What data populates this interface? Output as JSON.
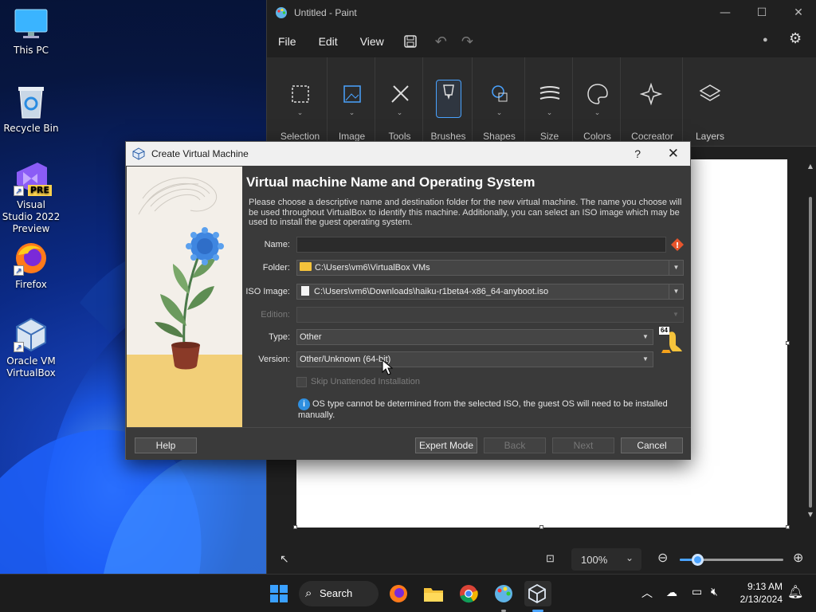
{
  "desktop": {
    "icons": [
      {
        "label": "This PC"
      },
      {
        "label": "Recycle Bin"
      },
      {
        "label": "Visual Studio 2022 Preview",
        "badge": "PRE"
      },
      {
        "label": "Firefox"
      },
      {
        "label": "Oracle VM VirtualBox"
      }
    ]
  },
  "paint": {
    "title": "Untitled - Paint",
    "menu": [
      "File",
      "Edit",
      "View"
    ],
    "ribbon_groups": [
      "Selection",
      "Image",
      "Tools",
      "Brushes",
      "Shapes",
      "Size",
      "Colors",
      "Cocreator",
      "Layers"
    ],
    "zoom": "100%",
    "zoom_slider_fraction": 0.17
  },
  "dialog": {
    "title": "Create Virtual Machine",
    "help_glyph": "?",
    "heading": "Virtual machine Name and Operating System",
    "description": "Please choose a descriptive name and destination folder for the new virtual machine. The name you choose will be used throughout VirtualBox to identify this machine. Additionally, you can select an ISO image which may be used to install the guest operating system.",
    "fields": {
      "name_label": "Name:",
      "name_value": "",
      "folder_label": "Folder:",
      "folder_value": "C:\\Users\\vm6\\VirtualBox VMs",
      "iso_label": "ISO Image:",
      "iso_value": "C:\\Users\\vm6\\Downloads\\haiku-r1beta4-x86_64-anyboot.iso",
      "edition_label": "Edition:",
      "edition_value": "",
      "type_label": "Type:",
      "type_value": "Other",
      "version_label": "Version:",
      "version_value": "Other/Unknown (64-bit)",
      "os_badge": "64"
    },
    "skip_unattended": "Skip Unattended Installation",
    "info_text": "OS type cannot be determined from the selected ISO, the guest OS will need to be installed manually.",
    "buttons": {
      "help": "Help",
      "expert": "Expert Mode",
      "back": "Back",
      "next": "Next",
      "cancel": "Cancel"
    }
  },
  "taskbar": {
    "search": "Search",
    "time": "9:13 AM",
    "date": "2/13/2024"
  },
  "colors": {
    "dialog_bg": "#3a3a3a",
    "paint_bg": "#202020",
    "accent": "#4aa3ff"
  }
}
